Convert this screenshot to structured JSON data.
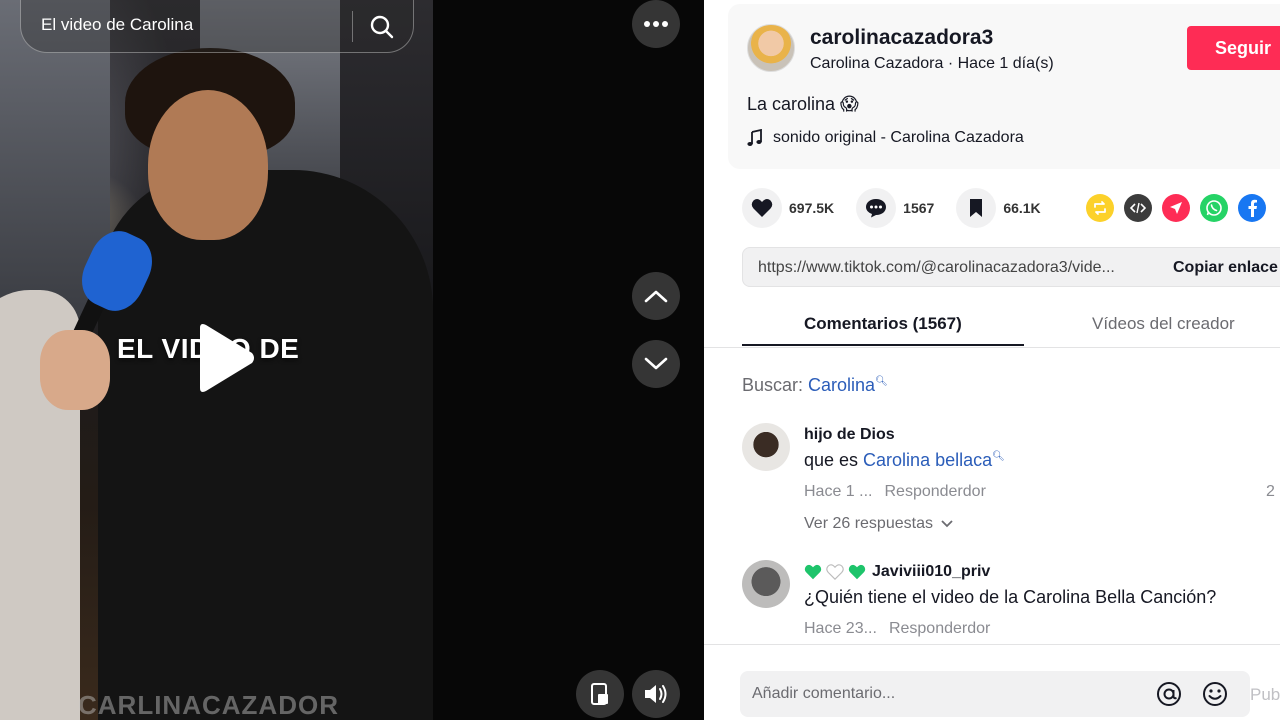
{
  "search": {
    "text": "El video de Carolina"
  },
  "video": {
    "overlay_text": "EL VIDEO DE",
    "watermark": "CARLINACAZADOR"
  },
  "creator": {
    "username": "carolinacazadora3",
    "display_name": "Carolina Cazadora",
    "separator": " · ",
    "posted": "Hace 1 día(s)",
    "follow_label": "Seguir"
  },
  "post": {
    "description": "La carolina 😱",
    "music": "sonido original - Carolina Cazadora"
  },
  "stats": {
    "likes": "697.5K",
    "comments": "1567",
    "saves": "66.1K"
  },
  "share": {
    "icons": [
      "repost-icon",
      "embed-icon",
      "send-icon",
      "whatsapp-icon",
      "facebook-icon"
    ],
    "colors": {
      "repost": "#fcd12a",
      "embed": "#3c3c3c",
      "send": "#fe2c55",
      "whatsapp": "#25d366",
      "facebook": "#1877f2"
    }
  },
  "link": {
    "url": "https://www.tiktok.com/@carolinacazadora3/vide...",
    "copy_label": "Copiar enlace"
  },
  "tabs": {
    "comments": "Comentarios (1567)",
    "creator_videos": "Vídeos del creador"
  },
  "comment_search": {
    "label": "Buscar: ",
    "term": "Carolina"
  },
  "comments": [
    {
      "author": "hijo de Dios",
      "text_prefix": "que es ",
      "text_link": "Carolina bellaca",
      "time": "Hace 1 ...",
      "reply_label": "Responder",
      "owner_tag": "dor",
      "likes": "2",
      "view_replies": "Ver 26 respuestas"
    },
    {
      "author": "Javiviii010_priv",
      "text": "¿Quién tiene el video de la Carolina Bella Canción?",
      "time": "Hace 23...",
      "reply_label": "Responder",
      "owner_tag": "dor"
    }
  ],
  "composer": {
    "placeholder": "Añadir comentario...",
    "post_label": "Publicar"
  },
  "colors": {
    "brand": "#fe2c55",
    "link": "#2b5db9",
    "text": "#161823"
  }
}
